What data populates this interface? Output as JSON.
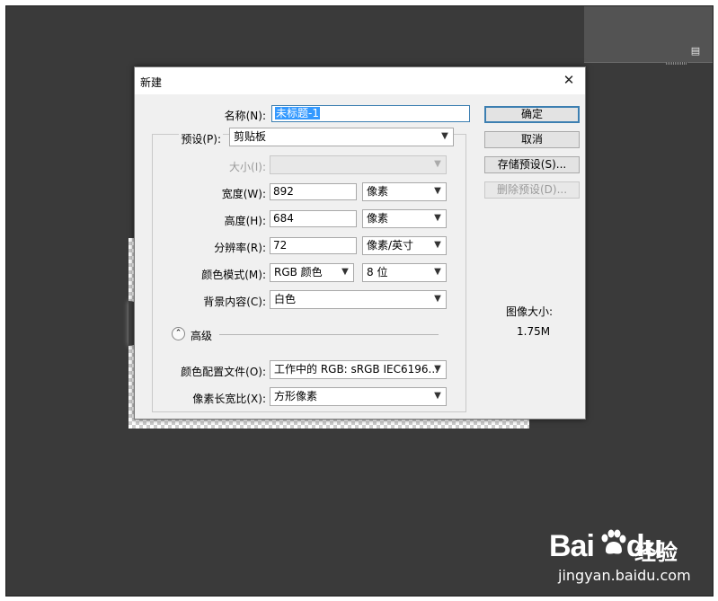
{
  "dialog": {
    "title": "新建",
    "close_glyph": "✕",
    "name": {
      "label": "名称(N):",
      "value": "未标题-1"
    },
    "preset": {
      "label": "预设(P):",
      "value": "剪贴板"
    },
    "size": {
      "label": "大小(I):",
      "value": ""
    },
    "width": {
      "label": "宽度(W):",
      "value": "892",
      "unit": "像素"
    },
    "height": {
      "label": "高度(H):",
      "value": "684",
      "unit": "像素"
    },
    "resolution": {
      "label": "分辨率(R):",
      "value": "72",
      "unit": "像素/英寸"
    },
    "color_mode": {
      "label": "颜色模式(M):",
      "value": "RGB 颜色",
      "depth": "8 位"
    },
    "background": {
      "label": "背景内容(C):",
      "value": "白色"
    },
    "advanced": {
      "label": "高级",
      "glyph": "⌃"
    },
    "color_profile": {
      "label": "颜色配置文件(O):",
      "value": "工作中的 RGB: sRGB IEC6196..."
    },
    "pixel_aspect": {
      "label": "像素长宽比(X):",
      "value": "方形像素"
    },
    "buttons": {
      "ok": "确定",
      "cancel": "取消",
      "save_preset": "存储预设(S)...",
      "delete_preset": "删除预设(D)..."
    },
    "image_size": {
      "title": "图像大小:",
      "value": "1.75M"
    }
  },
  "panel": {
    "menu_icon": "menu-icon"
  },
  "watermark": {
    "brand": "Bai",
    "brand2": "du",
    "product": "经验",
    "url": "jingyan.baidu.com"
  },
  "colors": {
    "workspace": "#3a3a3a",
    "dialog": "#f0f0f0",
    "accent": "#3c7fb1",
    "selection": "#3399ff"
  }
}
